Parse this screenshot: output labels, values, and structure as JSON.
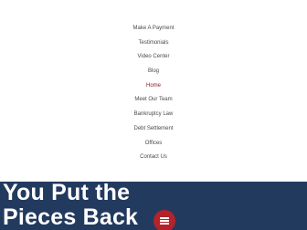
{
  "nav": {
    "items": [
      {
        "label": "Make A Payment"
      },
      {
        "label": "Testimonials"
      },
      {
        "label": "Video Center"
      },
      {
        "label": "Blog"
      },
      {
        "label": "Home"
      },
      {
        "label": "Meet Our Team"
      },
      {
        "label": "Bankruptcy Law"
      },
      {
        "label": "Debt Settlement"
      },
      {
        "label": "Offices"
      },
      {
        "label": "Contact Us"
      }
    ],
    "active_label": "Home",
    "toggle_icon": "hamburger-icon"
  },
  "hero": {
    "line1": "You Put the",
    "line2": "Pieces Back"
  },
  "colors": {
    "nav_text": "#4a4a4a",
    "nav_active": "#8b1c24",
    "hero_bg": "#233a5f",
    "hero_text": "#ffffff",
    "toggle_bg": "#b3232b"
  }
}
